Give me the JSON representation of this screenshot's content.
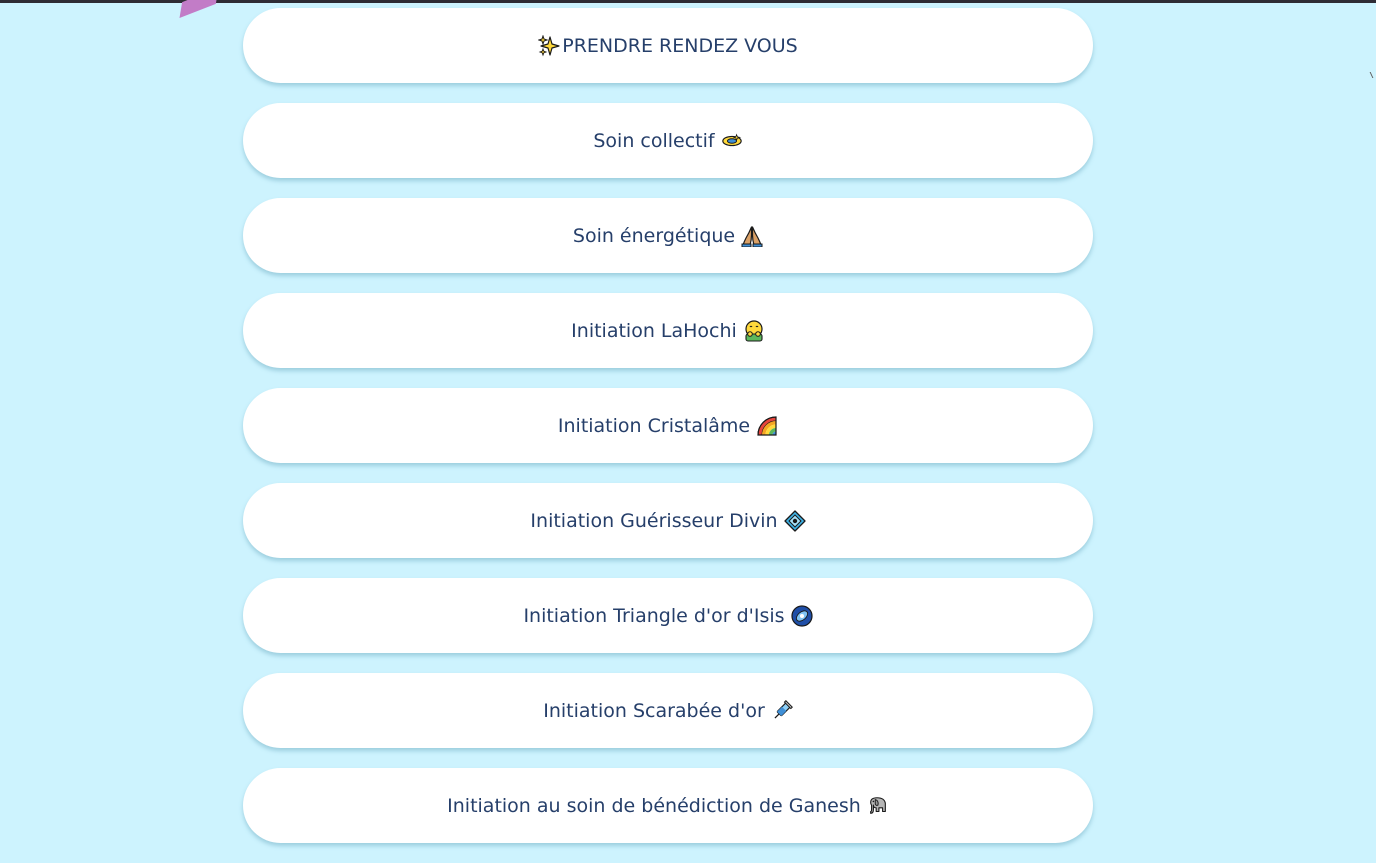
{
  "links": [
    {
      "label": "PRENDRE RENDEZ VOUS",
      "icon": "sparkles-icon",
      "icon_position": "before"
    },
    {
      "label": "Soin collectif",
      "icon": "dizzy-icon",
      "icon_position": "after"
    },
    {
      "label": "Soin énergétique",
      "icon": "folded-hands-icon",
      "icon_position": "after"
    },
    {
      "label": "Initiation LaHochi",
      "icon": "hugging-face-icon",
      "icon_position": "after"
    },
    {
      "label": "Initiation Cristalâme",
      "icon": "rainbow-icon",
      "icon_position": "after"
    },
    {
      "label": "Initiation Guérisseur Divin",
      "icon": "diamond-with-dot-icon",
      "icon_position": "after"
    },
    {
      "label": "Initiation Triangle d'or d'Isis",
      "icon": "galaxy-icon",
      "icon_position": "after"
    },
    {
      "label": "Initiation Scarabée d'or",
      "icon": "syringe-icon",
      "icon_position": "after"
    },
    {
      "label": "Initiation au soin de bénédiction de Ganesh",
      "icon": "elephant-icon",
      "icon_position": "after"
    }
  ],
  "colors": {
    "background": "#cdf3fe",
    "button": "#ffffff",
    "text": "#263f6a",
    "top_bar": "#2e2c35",
    "decoration": "#c27cc7"
  }
}
